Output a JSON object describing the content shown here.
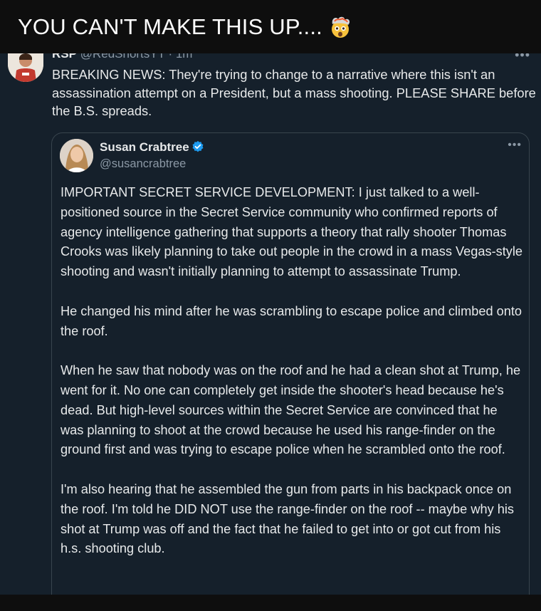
{
  "caption": {
    "text": "YOU CAN'T MAKE THIS UP....",
    "emoji": "exploding-head-icon"
  },
  "tweet": {
    "author_name": "RSP",
    "author_handle": "@RedShortsYT",
    "time": "1m",
    "text": "BREAKING NEWS: They're trying to change to a narrative where this isn't an assassination attempt on a President, but a mass shooting. PLEASE SHARE before the B.S. spreads."
  },
  "quoted_tweet": {
    "author_name": "Susan Crabtree",
    "author_handle": "@susancrabtree",
    "verified": true,
    "paragraphs": [
      "IMPORTANT SECRET SERVICE DEVELOPMENT: I just talked to a well-positioned source in the Secret Service community who confirmed reports of agency intelligence gathering that supports a theory that rally shooter Thomas Crooks was likely planning to take out people in the crowd in a mass Vegas-style shooting and wasn't initially planning to attempt to assassinate Trump.",
      "He changed his mind after he was scrambling to escape police and climbed onto the roof.",
      "When he saw that nobody was on the roof and he had a clean shot at Trump, he went for it. No one can completely get inside the shooter's head because he's dead. But high-level sources within the Secret Service are convinced that he was planning to shoot at the crowd because he used his range-finder on the ground first and was trying to escape police when he scrambled onto the roof.",
      "I'm also hearing that he assembled the gun from parts in his backpack once on the roof. I'm told he DID NOT use the range-finder on the roof -- maybe why his shot at Trump was off and the fact that he failed to get into or got cut from his h.s. shooting club."
    ]
  },
  "colors": {
    "background": "#15202b",
    "caption_bar": "#0e0e0e",
    "text_primary": "#e7e9ea",
    "text_secondary": "#8b98a5",
    "verified": "#1d9bf0"
  }
}
